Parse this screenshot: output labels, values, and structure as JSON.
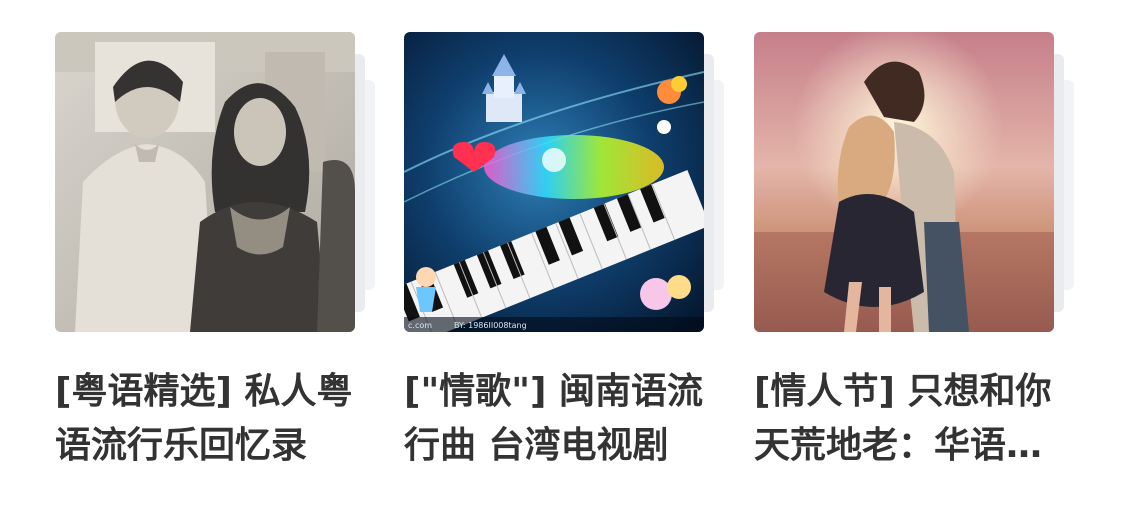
{
  "playlists": [
    {
      "title": "[粤语精选] 私人粤语流行乐回忆录",
      "cover_icon": "photo-couple-bw-icon"
    },
    {
      "title": "[\"情歌\"] 闽南语流行曲 台湾电视剧",
      "cover_icon": "piano-fantasy-art-icon",
      "cover_caption": "BY: 1986II008tang",
      "cover_caption_left": "c.com"
    },
    {
      "title": "[情人节] 只想和你天荒地老：华语情歌",
      "cover_icon": "couple-kissing-sunset-icon"
    }
  ]
}
